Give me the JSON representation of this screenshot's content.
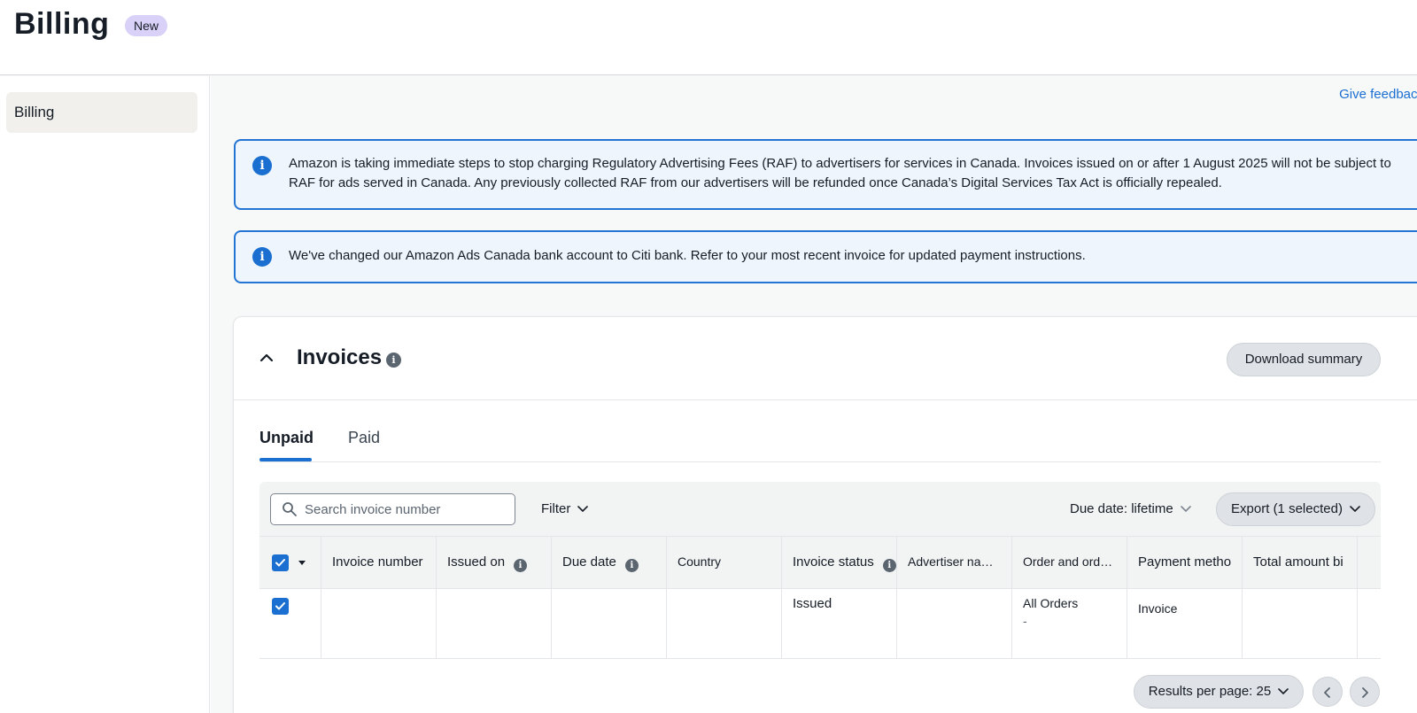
{
  "header": {
    "title": "Billing",
    "badge": "New"
  },
  "sidebar": {
    "items": [
      {
        "label": "Billing"
      }
    ]
  },
  "main": {
    "feedback_link": "Give feedback",
    "alerts": [
      {
        "text": "Amazon is taking immediate steps to stop charging Regulatory Advertising Fees (RAF) to advertisers for services in Canada. Invoices issued on or after 1 August 2025 will not be subject to RAF for ads served in Canada. Any previously collected RAF from our advertisers will be refunded once Canada’s Digital Services Tax Act is officially repealed."
      },
      {
        "text": "We've changed our Amazon Ads Canada bank account to Citi bank. Refer to your most recent invoice for updated payment instructions."
      }
    ]
  },
  "invoices": {
    "title": "Invoices",
    "download_label": "Download summary",
    "tabs": [
      {
        "label": "Unpaid",
        "active": true
      },
      {
        "label": "Paid",
        "active": false
      }
    ],
    "toolbar": {
      "search_placeholder": "Search invoice number",
      "filter_label": "Filter",
      "due_date_label": "Due date: lifetime",
      "export_label": "Export (1 selected)"
    },
    "columns": [
      "Invoice number",
      "Issued on",
      "Due date",
      "Country",
      "Invoice status",
      "Advertiser na…",
      "Order and ord…",
      "Payment metho",
      "Total amount bi"
    ],
    "rows": [
      {
        "selected": true,
        "invoice_number": "",
        "issued_on": "",
        "due_date": "",
        "country": "",
        "status": "Issued",
        "advertiser": "",
        "order": "All Orders",
        "order_sub": "-",
        "payment": "Invoice",
        "total": ""
      }
    ],
    "pagination": {
      "results_label": "Results per page: 25"
    }
  },
  "colors": {
    "accent": "#1a6fd1",
    "badge_bg": "#d9d1f7",
    "alert_bg": "#eef5fc"
  }
}
